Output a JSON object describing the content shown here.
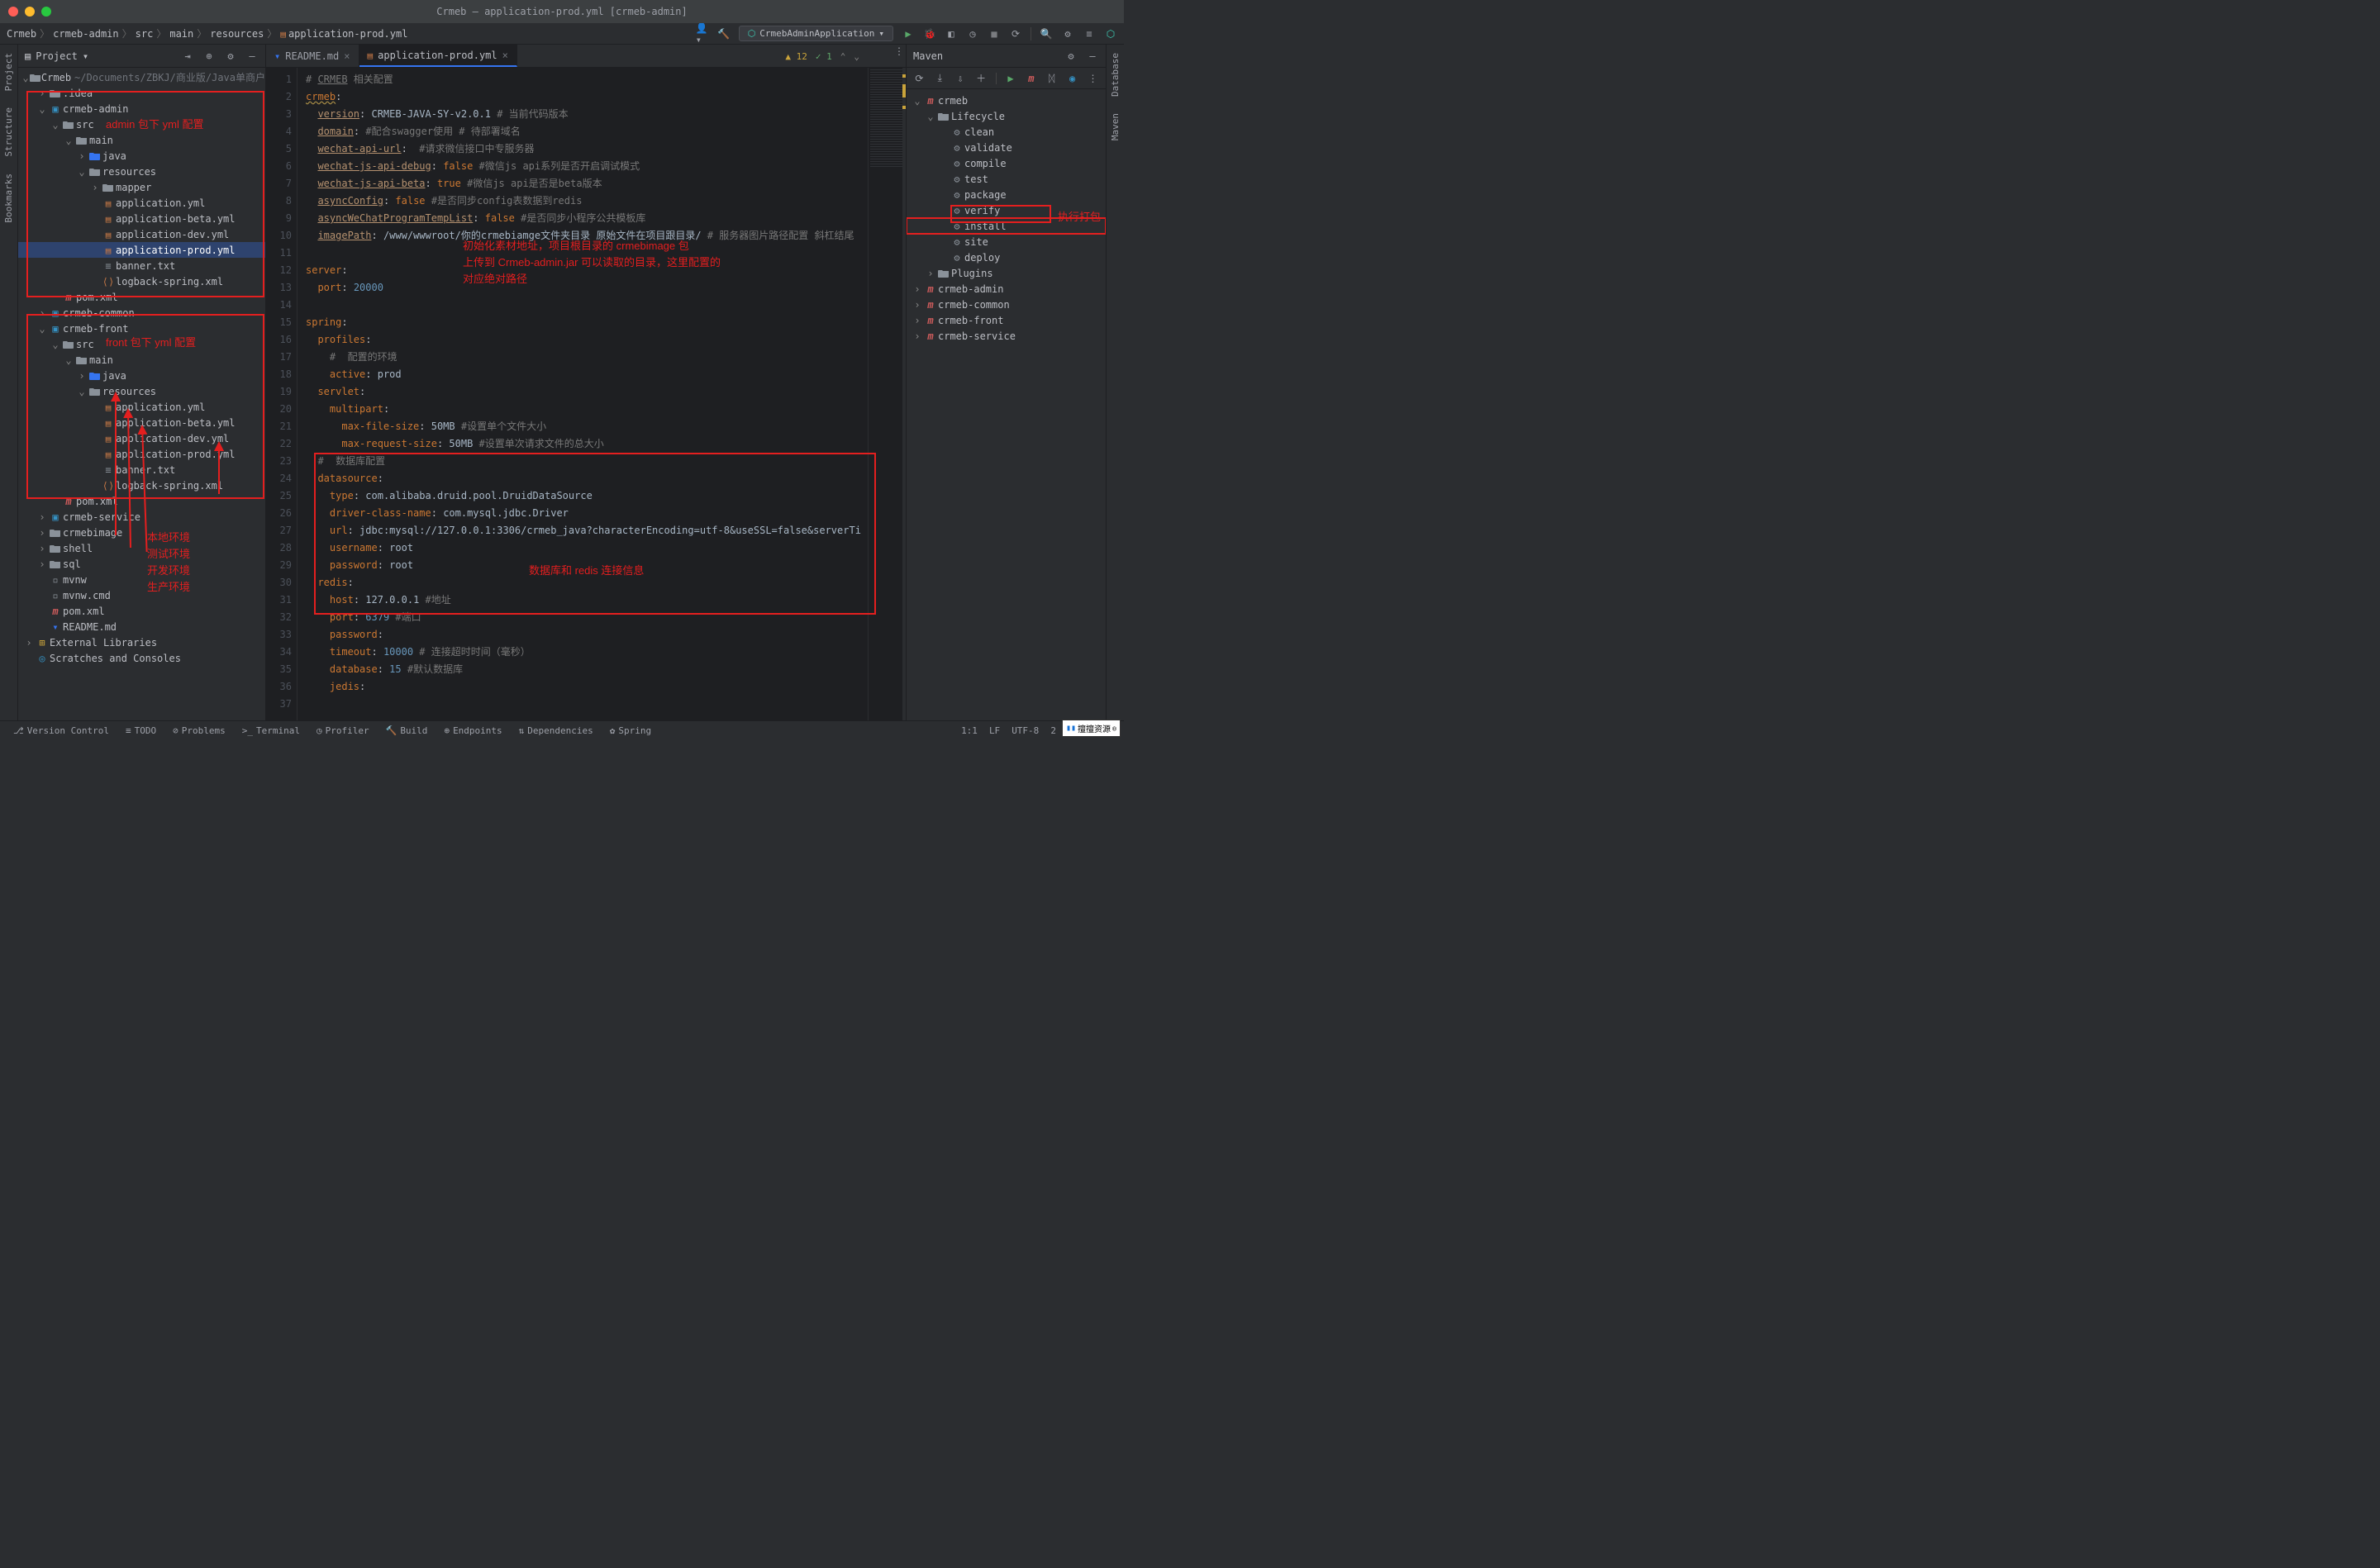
{
  "window": {
    "title": "Crmeb – application-prod.yml [crmeb-admin]"
  },
  "breadcrumbs": [
    "Crmeb",
    "crmeb-admin",
    "src",
    "main",
    "resources",
    "application-prod.yml"
  ],
  "run_config": "CrmebAdminApplication",
  "panels": {
    "project_title": "Project",
    "maven_title": "Maven"
  },
  "gutters": {
    "left": [
      "Project",
      "Structure",
      "Bookmarks"
    ],
    "right": [
      "Database",
      "Maven"
    ]
  },
  "tree": [
    {
      "d": 0,
      "a": "v",
      "i": "folder",
      "l": "Crmeb",
      "dim": "~/Documents/ZBKJ/商业版/Java单商户"
    },
    {
      "d": 1,
      "a": ">",
      "i": "folder",
      "l": ".idea"
    },
    {
      "d": 1,
      "a": "v",
      "i": "mod",
      "l": "crmeb-admin"
    },
    {
      "d": 2,
      "a": "v",
      "i": "folder",
      "l": "src"
    },
    {
      "d": 3,
      "a": "v",
      "i": "folder",
      "l": "main"
    },
    {
      "d": 4,
      "a": ">",
      "i": "folder",
      "l": "java",
      "blue": true
    },
    {
      "d": 4,
      "a": "v",
      "i": "folder",
      "l": "resources"
    },
    {
      "d": 5,
      "a": ">",
      "i": "folder",
      "l": "mapper"
    },
    {
      "d": 5,
      "a": "",
      "i": "yml",
      "l": "application.yml"
    },
    {
      "d": 5,
      "a": "",
      "i": "yml",
      "l": "application-beta.yml"
    },
    {
      "d": 5,
      "a": "",
      "i": "yml",
      "l": "application-dev.yml"
    },
    {
      "d": 5,
      "a": "",
      "i": "yml",
      "l": "application-prod.yml",
      "sel": true
    },
    {
      "d": 5,
      "a": "",
      "i": "txt",
      "l": "banner.txt"
    },
    {
      "d": 5,
      "a": "",
      "i": "xml",
      "l": "logback-spring.xml"
    },
    {
      "d": 2,
      "a": "",
      "i": "m",
      "l": "pom.xml"
    },
    {
      "d": 1,
      "a": ">",
      "i": "mod",
      "l": "crmeb-common"
    },
    {
      "d": 1,
      "a": "v",
      "i": "mod",
      "l": "crmeb-front"
    },
    {
      "d": 2,
      "a": "v",
      "i": "folder",
      "l": "src"
    },
    {
      "d": 3,
      "a": "v",
      "i": "folder",
      "l": "main"
    },
    {
      "d": 4,
      "a": ">",
      "i": "folder",
      "l": "java",
      "blue": true
    },
    {
      "d": 4,
      "a": "v",
      "i": "folder",
      "l": "resources"
    },
    {
      "d": 5,
      "a": "",
      "i": "yml",
      "l": "application.yml"
    },
    {
      "d": 5,
      "a": "",
      "i": "yml",
      "l": "application-beta.yml"
    },
    {
      "d": 5,
      "a": "",
      "i": "yml",
      "l": "application-dev.yml"
    },
    {
      "d": 5,
      "a": "",
      "i": "yml",
      "l": "application-prod.yml"
    },
    {
      "d": 5,
      "a": "",
      "i": "txt",
      "l": "banner.txt"
    },
    {
      "d": 5,
      "a": "",
      "i": "xml",
      "l": "logback-spring.xml"
    },
    {
      "d": 2,
      "a": "",
      "i": "m",
      "l": "pom.xml"
    },
    {
      "d": 1,
      "a": ">",
      "i": "mod",
      "l": "crmeb-service"
    },
    {
      "d": 1,
      "a": ">",
      "i": "folder",
      "l": "crmebimage"
    },
    {
      "d": 1,
      "a": ">",
      "i": "folder",
      "l": "shell"
    },
    {
      "d": 1,
      "a": ">",
      "i": "folder",
      "l": "sql"
    },
    {
      "d": 1,
      "a": "",
      "i": "file",
      "l": "mvnw"
    },
    {
      "d": 1,
      "a": "",
      "i": "file",
      "l": "mvnw.cmd"
    },
    {
      "d": 1,
      "a": "",
      "i": "m",
      "l": "pom.xml"
    },
    {
      "d": 1,
      "a": "",
      "i": "md",
      "l": "README.md"
    },
    {
      "d": 0,
      "a": ">",
      "i": "lib",
      "l": "External Libraries"
    },
    {
      "d": 0,
      "a": "",
      "i": "scratches",
      "l": "Scratches and Consoles"
    }
  ],
  "editor_tabs": [
    {
      "label": "README.md",
      "icon": "md",
      "active": false
    },
    {
      "label": "application-prod.yml",
      "icon": "yml",
      "active": true
    }
  ],
  "editor_inspection": {
    "warnings": "12",
    "checks": "1"
  },
  "code_lines": [
    {
      "n": 1,
      "html": "<span class='c-cmt'># <span style='text-decoration:underline'>CRMEB</span> 相关配置</span>"
    },
    {
      "n": 2,
      "html": "<span class='c-key c-underline'>crmeb</span>:"
    },
    {
      "n": 3,
      "html": "  <span class='c-prop'>version</span>: <span class='c-val'>CRMEB-JAVA-SY-v2.0.1</span> <span class='c-cmt'># 当前代码版本</span>"
    },
    {
      "n": 4,
      "html": "  <span class='c-prop'>domain</span>: <span class='c-cmt'>#配合swagger使用 # 待部署域名</span>"
    },
    {
      "n": 5,
      "html": "  <span class='c-prop'>wechat-api-url</span>:  <span class='c-cmt'>#请求微信接口中专服务器</span>"
    },
    {
      "n": 6,
      "html": "  <span class='c-prop'>wechat-js-api-debug</span>: <span class='c-key'>false</span> <span class='c-cmt'>#微信js api系列是否开启调试模式</span>"
    },
    {
      "n": 7,
      "html": "  <span class='c-prop'>wechat-js-api-beta</span>: <span class='c-key'>true</span> <span class='c-cmt'>#微信js api是否是beta版本</span>"
    },
    {
      "n": 8,
      "html": "  <span class='c-prop'>asyncConfig</span>: <span class='c-key'>false</span> <span class='c-cmt'>#是否同步config表数据到redis</span>"
    },
    {
      "n": 9,
      "html": "  <span class='c-prop'>asyncWeChatProgramTempList</span>: <span class='c-key'>false</span> <span class='c-cmt'>#是否同步小程序公共模板库</span>"
    },
    {
      "n": 10,
      "html": "  <span class='c-prop'>imagePath</span>: <span class='c-val'>/www/wwwroot/你的crmebiamge文件夹目录 原始文件在项目跟目录/</span> <span class='c-cmt'># 服务器图片路径配置 斜杠结尾</span>"
    },
    {
      "n": 11,
      "html": ""
    },
    {
      "n": 12,
      "html": "<span class='c-key'>server</span>:"
    },
    {
      "n": 13,
      "html": "  <span class='c-key'>port</span>: <span class='c-num'>20000</span>"
    },
    {
      "n": 14,
      "html": ""
    },
    {
      "n": 15,
      "html": "<span class='c-key'>spring</span>:"
    },
    {
      "n": 16,
      "html": "  <span class='c-key'>profiles</span>:"
    },
    {
      "n": 17,
      "html": "    <span class='c-cmt'>#  配置的环境</span>"
    },
    {
      "n": 18,
      "html": "    <span class='c-key'>active</span>: <span class='c-val'>prod</span>"
    },
    {
      "n": 19,
      "html": "  <span class='c-key'>servlet</span>:"
    },
    {
      "n": 20,
      "html": "    <span class='c-key'>multipart</span>:"
    },
    {
      "n": 21,
      "html": "      <span class='c-key'>max-file-size</span>: <span class='c-val'>50MB</span> <span class='c-cmt'>#设置单个文件大小</span>"
    },
    {
      "n": 22,
      "html": "      <span class='c-key'>max-request-size</span>: <span class='c-val'>50MB</span> <span class='c-cmt'>#设置单次请求文件的总大小</span>"
    },
    {
      "n": 23,
      "html": "  <span class='c-cmt'>#  数据库配置</span>"
    },
    {
      "n": 24,
      "html": "  <span class='c-key'>datasource</span>:"
    },
    {
      "n": 25,
      "html": "    <span class='c-key'>type</span>: <span class='c-val'>com.alibaba.druid.pool.DruidDataSource</span>"
    },
    {
      "n": 26,
      "html": "    <span class='c-key'>driver-class-name</span>: <span class='c-val'>com.mysql.jdbc.Driver</span>"
    },
    {
      "n": 27,
      "html": "    <span class='c-key'>url</span>: <span class='c-val'>jdbc:mysql://127.0.0.1:3306/crmeb_java?characterEncoding=utf-8&useSSL=false&serverTi</span>"
    },
    {
      "n": 28,
      "html": "    <span class='c-key'>username</span>: <span class='c-val'>root</span>"
    },
    {
      "n": 29,
      "html": "    <span class='c-key'>password</span>: <span class='c-val'>root</span>"
    },
    {
      "n": 30,
      "html": "  <span class='c-key'>redis</span>:"
    },
    {
      "n": 31,
      "html": "    <span class='c-key'>host</span>: <span class='c-val'>127.0.0.1</span> <span class='c-cmt'>#地址</span>"
    },
    {
      "n": 32,
      "html": "    <span class='c-key'>port</span>: <span class='c-num'>6379</span> <span class='c-cmt'>#端口</span>"
    },
    {
      "n": 33,
      "html": "    <span class='c-key'>password</span>:"
    },
    {
      "n": 34,
      "html": "    <span class='c-key'>timeout</span>: <span class='c-num'>10000</span> <span class='c-cmt'># 连接超时时间（毫秒）</span>"
    },
    {
      "n": 35,
      "html": "    <span class='c-key'>database</span>: <span class='c-num'>15</span> <span class='c-cmt'>#默认数据库</span>"
    },
    {
      "n": 36,
      "html": "    <span class='c-key'>jedis</span>:"
    },
    {
      "n": 37,
      "html": ""
    }
  ],
  "maven_tree": [
    {
      "d": 0,
      "a": "v",
      "i": "m",
      "l": "crmeb"
    },
    {
      "d": 1,
      "a": "v",
      "i": "folder",
      "l": "Lifecycle"
    },
    {
      "d": 2,
      "i": "gear",
      "l": "clean"
    },
    {
      "d": 2,
      "i": "gear",
      "l": "validate"
    },
    {
      "d": 2,
      "i": "gear",
      "l": "compile"
    },
    {
      "d": 2,
      "i": "gear",
      "l": "test"
    },
    {
      "d": 2,
      "i": "gear",
      "l": "package"
    },
    {
      "d": 2,
      "i": "gear",
      "l": "verify"
    },
    {
      "d": 2,
      "i": "gear",
      "l": "install",
      "hl": true
    },
    {
      "d": 2,
      "i": "gear",
      "l": "site"
    },
    {
      "d": 2,
      "i": "gear",
      "l": "deploy"
    },
    {
      "d": 1,
      "a": ">",
      "i": "folder",
      "l": "Plugins"
    },
    {
      "d": 0,
      "a": ">",
      "i": "m",
      "l": "crmeb-admin"
    },
    {
      "d": 0,
      "a": ">",
      "i": "m",
      "l": "crmeb-common"
    },
    {
      "d": 0,
      "a": ">",
      "i": "m",
      "l": "crmeb-front"
    },
    {
      "d": 0,
      "a": ">",
      "i": "m",
      "l": "crmeb-service"
    }
  ],
  "status_tabs": [
    "Version Control",
    "TODO",
    "Problems",
    "Terminal",
    "Profiler",
    "Build",
    "Endpoints",
    "Dependencies",
    "Spring"
  ],
  "status_right": {
    "pos": "1:1",
    "le": "LF",
    "enc": "UTF-8",
    "indent": "2 spaces"
  },
  "annotations": {
    "admin_box_label": "admin 包下 yml 配置",
    "front_box_label": "front 包下 yml 配置",
    "init_asset": "初始化素材地址，项目根目录的 crmebimage 包\n上传到 Crmeb-admin.jar 可以读取的目录，这里配置的\n对应绝对路径",
    "db_redis": "数据库和 redis 连接信息",
    "exec": "执行打包",
    "env": [
      "本地环境",
      "测试环境",
      "开发环境",
      "生产环境"
    ]
  },
  "watermark": "擅擅资源"
}
